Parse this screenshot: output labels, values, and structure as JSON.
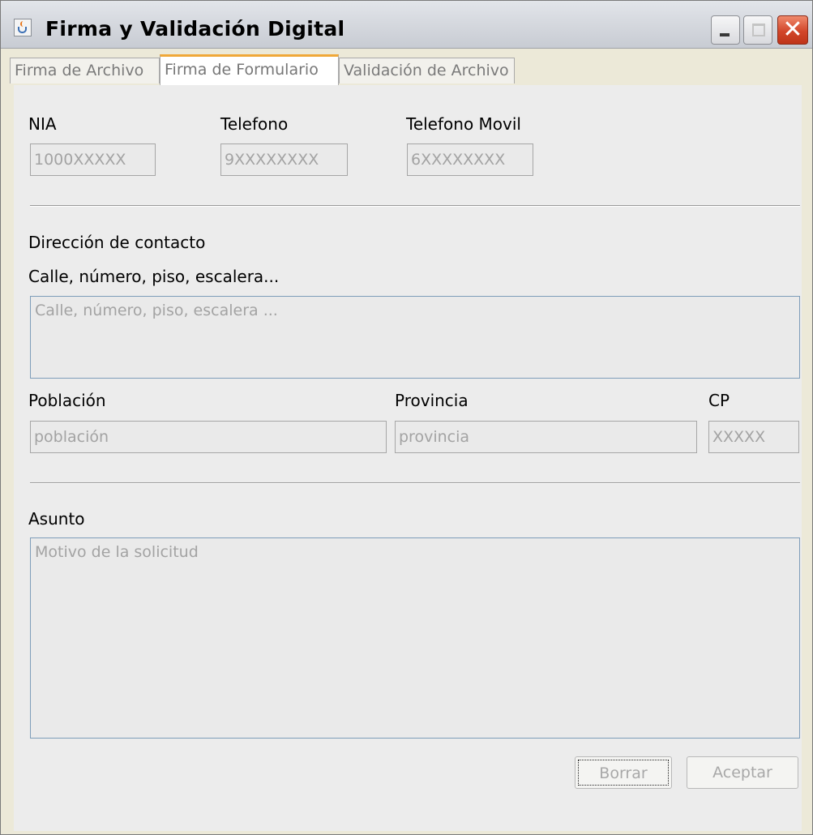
{
  "window": {
    "title": "Firma y Validación Digital",
    "icon": "java-cup-icon",
    "controls": [
      "minimize-icon",
      "maximize-icon",
      "close-icon"
    ]
  },
  "tabs": [
    {
      "label": "Firma de Archivo",
      "selected": false
    },
    {
      "label": "Firma de Formulario",
      "selected": true
    },
    {
      "label": "Validación de Archivo",
      "selected": false
    }
  ],
  "form": {
    "nia": {
      "label": "NIA",
      "placeholder": "1000XXXXX"
    },
    "telefono": {
      "label": "Telefono",
      "placeholder": "9XXXXXXXX"
    },
    "telefono_movil": {
      "label": "Telefono Movil",
      "placeholder": "6XXXXXXXX"
    },
    "direccion": {
      "section_label": "Dirección de contacto",
      "label": "Calle, número, piso, escalera...",
      "placeholder": "Calle, número, piso, escalera ..."
    },
    "poblacion": {
      "label": "Población",
      "placeholder": "población"
    },
    "provincia": {
      "label": "Provincia",
      "placeholder": "provincia"
    },
    "cp": {
      "label": "CP",
      "placeholder": "XXXXX"
    },
    "asunto": {
      "label": "Asunto",
      "placeholder": "Motivo de la solicitud"
    }
  },
  "buttons": {
    "borrar": "Borrar",
    "aceptar": "Aceptar"
  },
  "colors": {
    "selected_tab_accent": "#f0a838",
    "close_button": "#d2462a",
    "panel_bg": "#ececec",
    "placeholder_text": "#a3a3a3"
  }
}
